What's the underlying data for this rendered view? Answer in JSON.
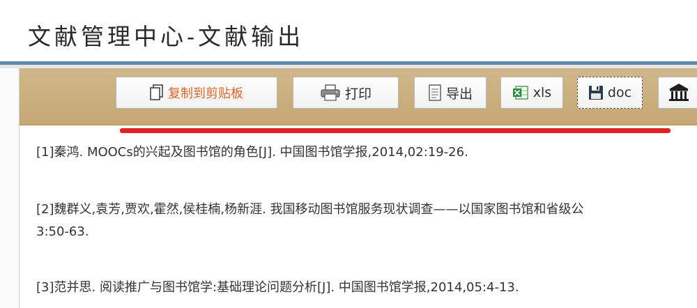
{
  "header": {
    "title": "文献管理中心-文献输出"
  },
  "toolbar": {
    "copy_label": "复制到剪贴板",
    "print_label": "打印",
    "export_label": "导出",
    "xls_label": "xls",
    "doc_label": "doc"
  },
  "icons": {
    "copy": "copy-icon",
    "print": "printer-icon",
    "export": "document-icon",
    "xls": "excel-icon",
    "doc": "floppy-disk-icon",
    "more": "library-icon"
  },
  "colors": {
    "toolbar_bg": "#c9ab7a",
    "accent_blue": "#5e89a8",
    "highlight_red": "#e02424",
    "copy_text": "#d2662c"
  },
  "references": [
    {
      "text": "[1]秦鸿. MOOCs的兴起及图书馆的角色[J]. 中国图书馆学报,2014,02:19-26."
    },
    {
      "text": "[2]魏群义,袁芳,贾欢,霍然,侯桂楠,杨新涯. 我国移动图书馆服务现状调查——以国家图书馆和省级公",
      "continuation": "3:50-63."
    },
    {
      "text": "[3]范并思. 阅读推广与图书馆学:基础理论问题分析[J]. 中国图书馆学报,2014,05:4-13."
    }
  ]
}
